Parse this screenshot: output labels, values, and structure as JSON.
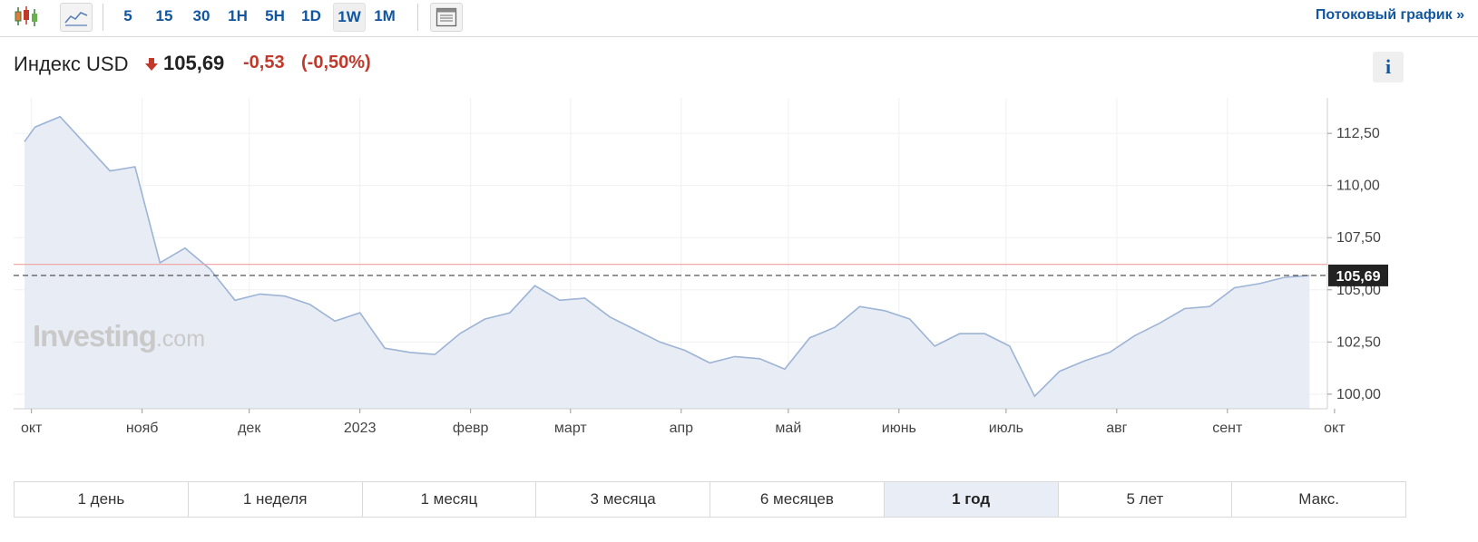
{
  "toolbar": {
    "intervals": [
      "5",
      "15",
      "30",
      "1H",
      "5H",
      "1D",
      "1W",
      "1M"
    ],
    "active_interval": "1W",
    "stream_link": "Потоковый график »"
  },
  "header": {
    "title": "Индекс USD",
    "price": "105,69",
    "change": "-0,53",
    "change_pct": "(-0,50%)",
    "info_label": "i"
  },
  "watermark": {
    "brand": "Investing",
    "suffix": ".com"
  },
  "colors": {
    "line": "#9db4d6",
    "fill": "#e8ecf4",
    "down": "#c0392b",
    "ref_line": "#f2a0a0",
    "accent": "#1256a0"
  },
  "chart_data": {
    "type": "area",
    "x_tick_labels": [
      "окт",
      "нояб",
      "дек",
      "2023",
      "февр",
      "март",
      "апр",
      "май",
      "июнь",
      "июль",
      "авг",
      "сент",
      "окт"
    ],
    "y_tick_labels": [
      "112,50",
      "110,00",
      "107,50",
      "105,00",
      "102,50",
      "100,00"
    ],
    "ylim": [
      99.3,
      114.2
    ],
    "y_ticks": [
      112.5,
      110,
      107.5,
      105,
      102.5,
      100
    ],
    "last_price": 105.69,
    "last_price_label": "105,69",
    "reference_line": 106.22,
    "x_start": "2022-09-26",
    "x_end": "2023-09-29",
    "x_ticks": [
      "2022-10-01",
      "2022-11-01",
      "2022-12-01",
      "2023-01-01",
      "2023-02-01",
      "2023-03-01",
      "2023-04-01",
      "2023-05-01",
      "2023-06-01",
      "2023-07-01",
      "2023-08-01",
      "2023-09-01",
      "2023-10-01"
    ],
    "series": [
      {
        "values": [
          [
            "2022-09-25",
            112.1
          ],
          [
            "2022-10-02",
            112.8
          ],
          [
            "2022-10-09",
            113.3
          ],
          [
            "2022-10-16",
            112.0
          ],
          [
            "2022-10-23",
            110.7
          ],
          [
            "2022-10-30",
            110.9
          ],
          [
            "2022-11-06",
            106.3
          ],
          [
            "2022-11-13",
            107.0
          ],
          [
            "2022-11-20",
            106.0
          ],
          [
            "2022-11-27",
            104.5
          ],
          [
            "2022-12-04",
            104.8
          ],
          [
            "2022-12-11",
            104.7
          ],
          [
            "2022-12-18",
            104.3
          ],
          [
            "2022-12-25",
            103.5
          ],
          [
            "2023-01-01",
            103.9
          ],
          [
            "2023-01-08",
            102.2
          ],
          [
            "2023-01-15",
            102.0
          ],
          [
            "2023-01-22",
            101.9
          ],
          [
            "2023-01-29",
            102.9
          ],
          [
            "2023-02-05",
            103.6
          ],
          [
            "2023-02-12",
            103.9
          ],
          [
            "2023-02-19",
            105.2
          ],
          [
            "2023-02-26",
            104.5
          ],
          [
            "2023-03-05",
            104.6
          ],
          [
            "2023-03-12",
            103.7
          ],
          [
            "2023-03-19",
            103.1
          ],
          [
            "2023-03-26",
            102.5
          ],
          [
            "2023-04-02",
            102.1
          ],
          [
            "2023-04-09",
            101.5
          ],
          [
            "2023-04-16",
            101.8
          ],
          [
            "2023-04-23",
            101.7
          ],
          [
            "2023-04-30",
            101.2
          ],
          [
            "2023-05-07",
            102.7
          ],
          [
            "2023-05-14",
            103.2
          ],
          [
            "2023-05-21",
            104.2
          ],
          [
            "2023-05-28",
            104.0
          ],
          [
            "2023-06-04",
            103.6
          ],
          [
            "2023-06-11",
            102.3
          ],
          [
            "2023-06-18",
            102.9
          ],
          [
            "2023-06-25",
            102.9
          ],
          [
            "2023-07-02",
            102.3
          ],
          [
            "2023-07-09",
            99.9
          ],
          [
            "2023-07-16",
            101.1
          ],
          [
            "2023-07-23",
            101.6
          ],
          [
            "2023-07-30",
            102.0
          ],
          [
            "2023-08-06",
            102.8
          ],
          [
            "2023-08-13",
            103.4
          ],
          [
            "2023-08-20",
            104.1
          ],
          [
            "2023-08-27",
            104.2
          ],
          [
            "2023-09-03",
            105.1
          ],
          [
            "2023-09-10",
            105.3
          ],
          [
            "2023-09-17",
            105.6
          ],
          [
            "2023-09-24",
            105.69
          ]
        ]
      }
    ],
    "grid": true
  },
  "ranges": [
    "1 день",
    "1 неделя",
    "1 месяц",
    "3 месяца",
    "6 месяцев",
    "1 год",
    "5 лет",
    "Макс."
  ],
  "active_range": "1 год"
}
